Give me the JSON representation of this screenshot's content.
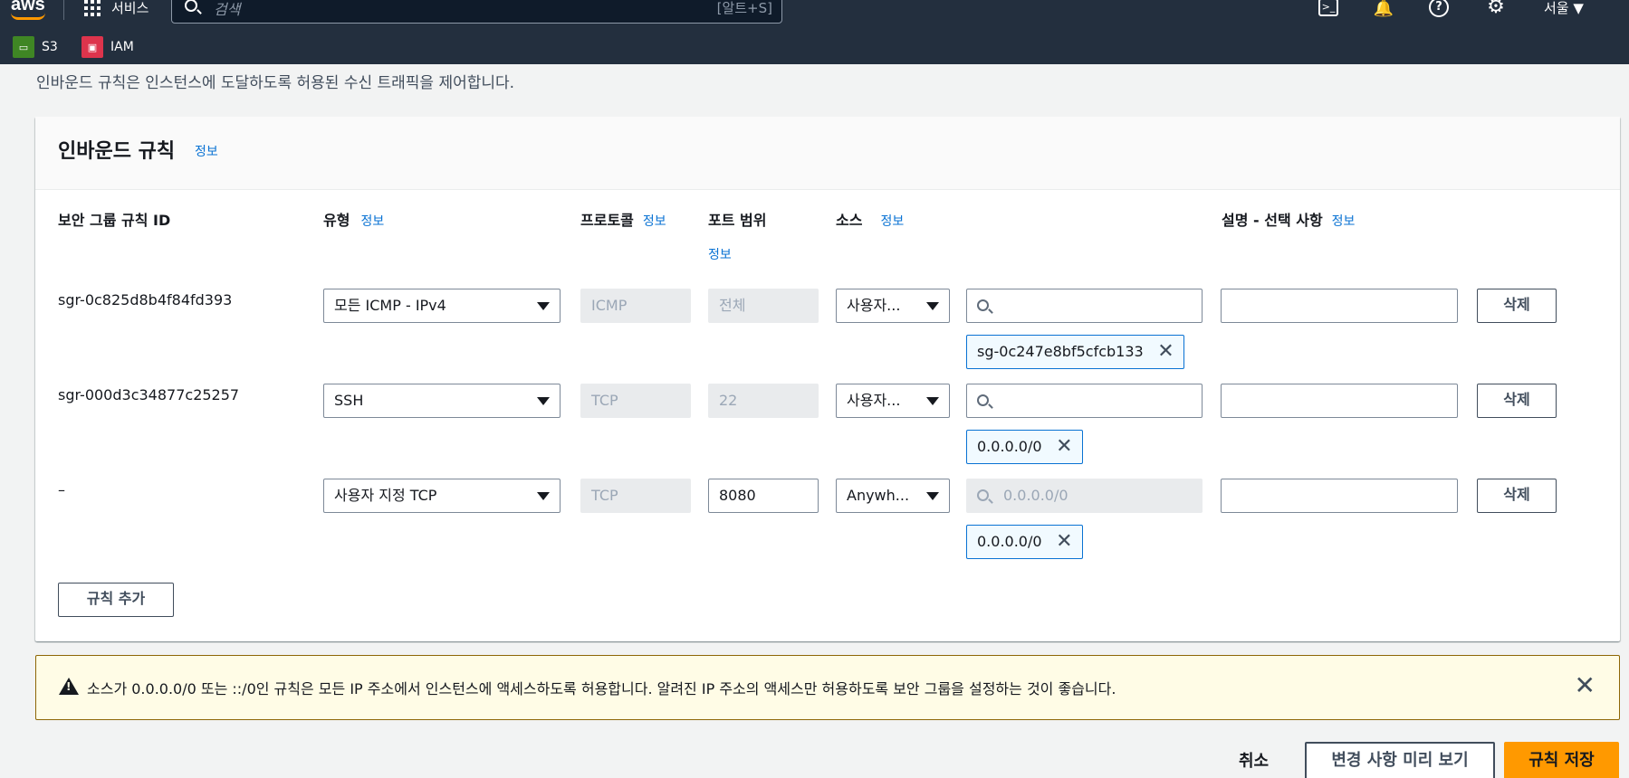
{
  "nav": {
    "logo": "aws",
    "services_label": "서비스",
    "search_placeholder": "검색",
    "search_shortcut": "[알트+S]",
    "region": "서울 ▼",
    "favorites": [
      {
        "label": "S3",
        "icon": "s3-icon",
        "color": "#3f8624"
      },
      {
        "label": "IAM",
        "icon": "iam-icon",
        "color": "#dd344c"
      }
    ],
    "icons": [
      "cloudshell-icon",
      "bell-icon",
      "help-icon",
      "gear-icon"
    ]
  },
  "intro_text": "인바운드 규칙은 인스턴스에 도달하도록 허용된 수신 트래픽을 제어합니다.",
  "panel": {
    "title": "인바운드 규칙",
    "info": "정보",
    "columns": {
      "rule_id": "보안 그룹 규칙 ID",
      "type": "유형",
      "protocol": "프로토콜",
      "port_range": "포트 범위",
      "source": "소스",
      "description": "설명 - 선택 사항",
      "info": "정보"
    },
    "rows": [
      {
        "id": "sgr-0c825d8b4f84fd393",
        "type": "모든 ICMP - IPv4",
        "protocol": "ICMP",
        "port": "전체",
        "source_type": "사용자...",
        "source_search": "",
        "token": "sg-0c247e8bf5cfcb133",
        "description": "",
        "delete": "삭제"
      },
      {
        "id": "sgr-000d3c34877c25257",
        "type": "SSH",
        "protocol": "TCP",
        "port": "22",
        "source_type": "사용자...",
        "source_search": "",
        "token": "0.0.0.0/0",
        "description": "",
        "delete": "삭제"
      },
      {
        "id": "–",
        "type": "사용자 지정 TCP",
        "protocol": "TCP",
        "port": "8080",
        "source_type": "Anywh...",
        "source_search": "0.0.0.0/0",
        "token": "0.0.0.0/0",
        "description": "",
        "delete": "삭제"
      }
    ],
    "add_rule": "규칙 추가"
  },
  "alert": {
    "text": "소스가 0.0.0.0/0 또는 ::/0인 규칙은 모든 IP 주소에서 인스턴스에 액세스하도록 허용합니다. 알려진 IP 주소의 액세스만 허용하도록 보안 그룹을 설정하는 것이 좋습니다.",
    "close": "✕"
  },
  "actions": {
    "cancel": "취소",
    "preview": "변경 사항 미리 보기",
    "save": "규칙 저장"
  }
}
